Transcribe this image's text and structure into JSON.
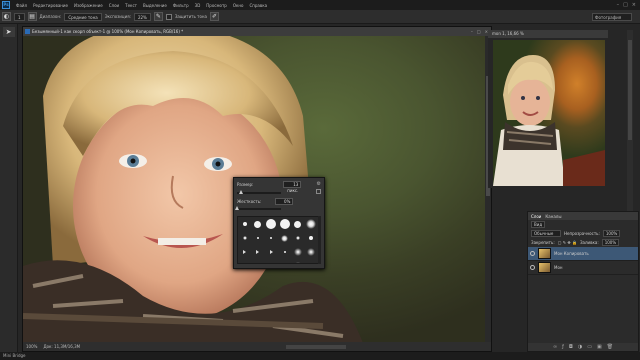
{
  "menubar": {
    "logo": "Ps",
    "items": [
      "Файл",
      "Редактирование",
      "Изображение",
      "Слои",
      "Текст",
      "Выделение",
      "Фильтр",
      "3D",
      "Просмотр",
      "Окно",
      "Справка"
    ],
    "window_controls": [
      "–",
      "□",
      "×"
    ]
  },
  "options": {
    "brush_size": "1",
    "mode_label": "Диапазон:",
    "mode_value": "Средние тона",
    "exposure_label": "Экспозиция:",
    "exposure_value": "22%",
    "protect_label": "Защитить тона",
    "workspace": "Фотография"
  },
  "document": {
    "title": "Безымянный-1 как скорп объект-1 @ 100% (Мон Копировать, RGB/16) *",
    "status_zoom": "100%",
    "status_doc": "Док: 11,3M/16,3M"
  },
  "brush_picker": {
    "size_label": "Размер:",
    "size_value": "13 пикс.",
    "hardness_label": "Жесткость:",
    "hardness_value": "0%",
    "size_slider_fraction": 0.1,
    "hardness_slider_fraction": 0.0
  },
  "navigator": {
    "tab": "mon 1, 16,66 %"
  },
  "layers": {
    "tabs": [
      "Слои",
      "Каналы"
    ],
    "kind_label": "Вид",
    "blend_mode": "Обычные",
    "opacity_label": "Непрозрачность:",
    "opacity_value": "100%",
    "lock_label": "Закрепить:",
    "fill_label": "Заливка:",
    "fill_value": "100%",
    "items": [
      {
        "name": "Мон Копировать",
        "selected": true
      },
      {
        "name": "Мон",
        "selected": false
      }
    ],
    "bottom_icons": [
      "link-icon",
      "fx-icon",
      "mask-icon",
      "adjustment-icon",
      "folder-icon",
      "new-layer-icon",
      "trash-icon"
    ]
  },
  "statusbar": {
    "text": "Mini Bridge"
  }
}
